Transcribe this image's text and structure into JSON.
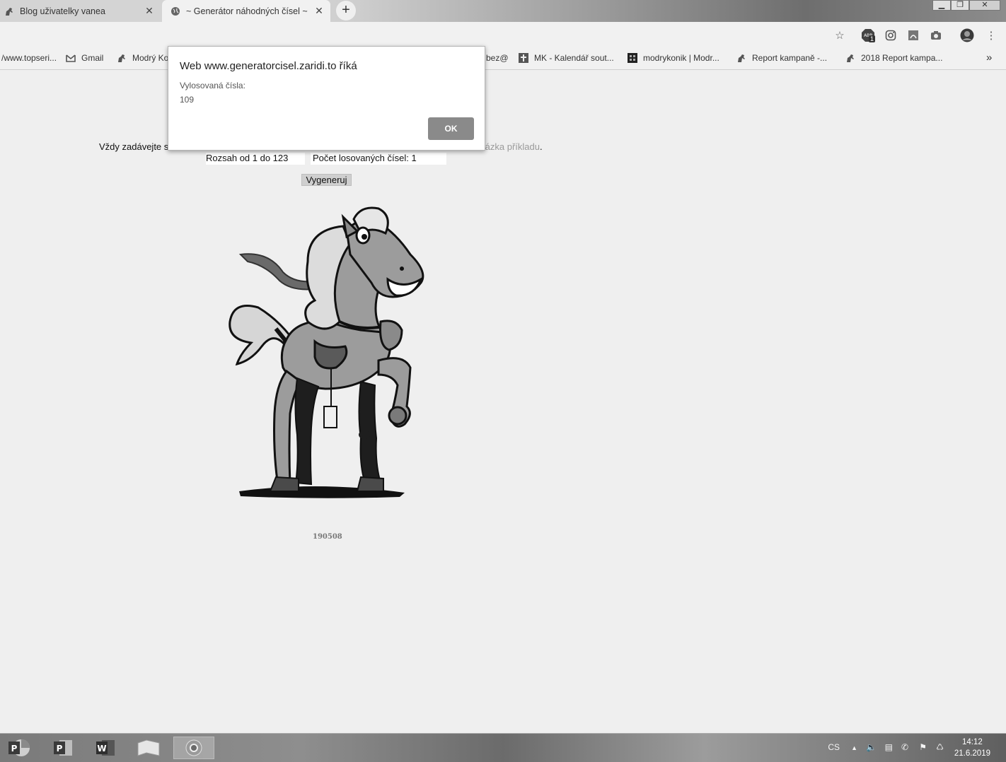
{
  "browser": {
    "tabs": [
      {
        "title": "Blog uživatelky vanea",
        "icon": "horse-icon"
      },
      {
        "title": "~ Generátor náhodných čísel ~",
        "icon": "globe-icon"
      }
    ],
    "new_tab_label": "+",
    "close_glyph": "✕"
  },
  "toolbar_icons": [
    "star-icon",
    "abp-extension-icon",
    "instagram-icon",
    "pdf-icon",
    "camera-icon",
    "profile-avatar",
    "menu-icon"
  ],
  "abp_badge": "1",
  "bookmarks": [
    {
      "label": "/www.topseri...",
      "icon": "page-icon"
    },
    {
      "label": "Gmail",
      "icon": "gmail-icon"
    },
    {
      "label": "Modrý Ko",
      "icon": "horse-icon"
    },
    {
      "label": "bez@",
      "icon": ""
    },
    {
      "label": "MK - Kalendář sout...",
      "icon": "calendar-icon"
    },
    {
      "label": "modrykonik | Modr...",
      "icon": "grid-icon"
    },
    {
      "label": "Report kampaně -...",
      "icon": "horse-icon"
    },
    {
      "label": "2018 Report kampa...",
      "icon": "horse-icon"
    }
  ],
  "bookmarks_more": "»",
  "page": {
    "intro_start": "Vždy zadávejte s",
    "intro_link": "ukázka příkladu",
    "intro_end": ".",
    "range_label": "Rozsah od 1 do 123",
    "count_label": "Počet losovaných čísel: 1",
    "generate_button": "Vygeneruj",
    "version": "190508"
  },
  "dialog": {
    "title": "Web www.generatorcisel.zaridi.to říká",
    "message_label": "Vylosovaná čísla:",
    "message_value": "109",
    "ok_label": "OK"
  },
  "taskbar": {
    "apps": [
      "P",
      "P",
      "W",
      "",
      ""
    ],
    "language": "CS",
    "time": "14:12",
    "date": "21.6.2019"
  }
}
